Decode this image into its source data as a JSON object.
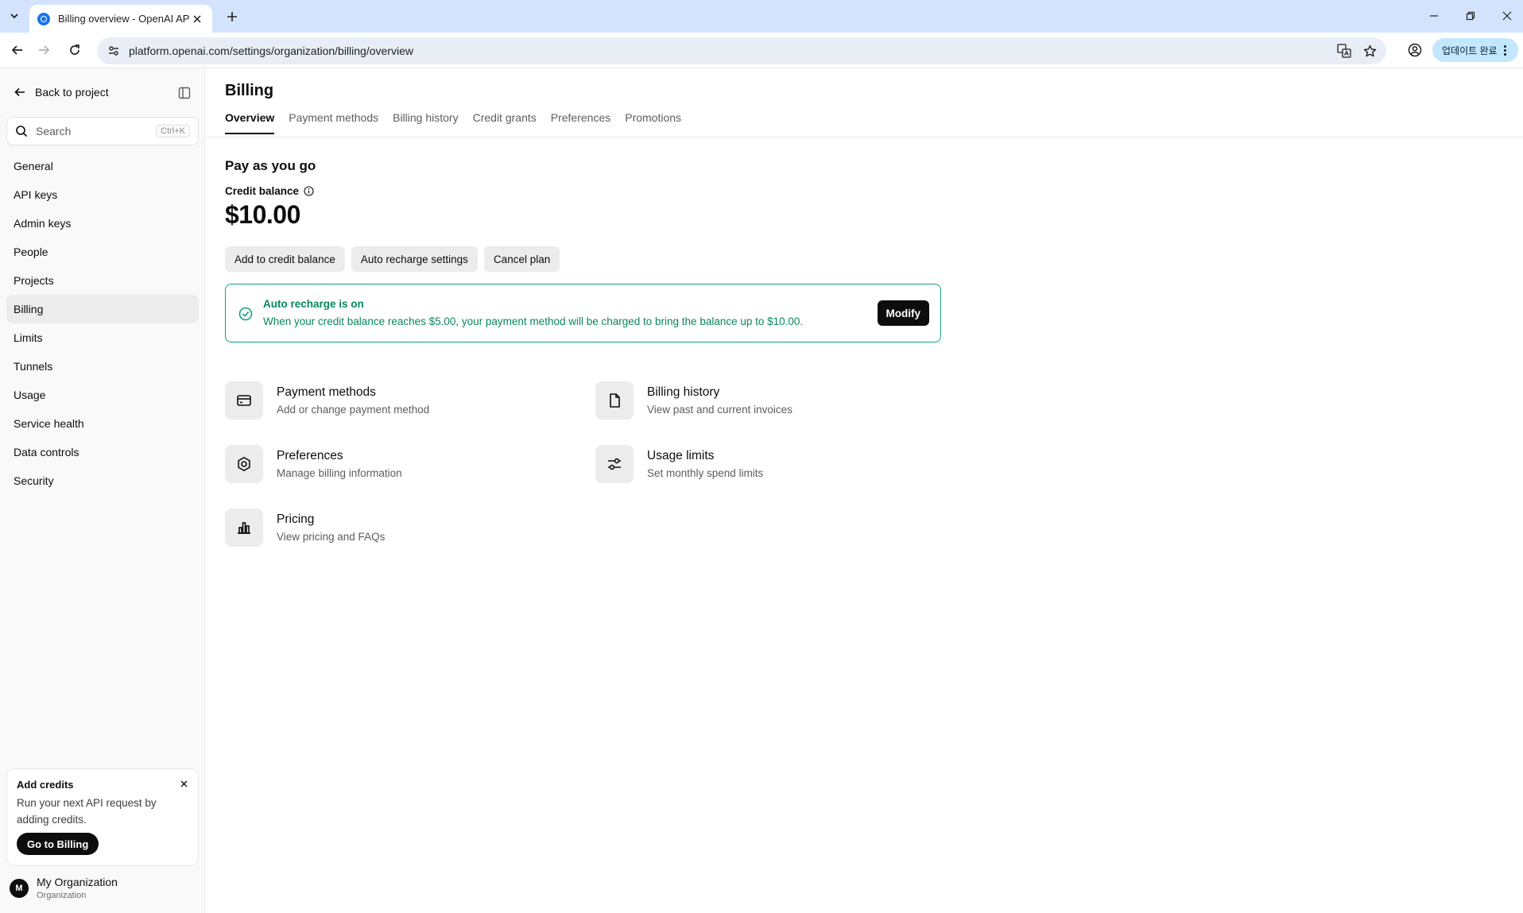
{
  "browser": {
    "tab_title": "Billing overview - OpenAI API",
    "url": "platform.openai.com/settings/organization/billing/overview",
    "update_label": "업데이트 완료"
  },
  "sidebar": {
    "back_label": "Back to project",
    "search": {
      "placeholder": "Search",
      "shortcut": "Ctrl+K"
    },
    "items": [
      {
        "label": "General"
      },
      {
        "label": "API keys"
      },
      {
        "label": "Admin keys"
      },
      {
        "label": "People"
      },
      {
        "label": "Projects"
      },
      {
        "label": "Billing",
        "active": true
      },
      {
        "label": "Limits"
      },
      {
        "label": "Tunnels"
      },
      {
        "label": "Usage"
      },
      {
        "label": "Service health"
      },
      {
        "label": "Data controls"
      },
      {
        "label": "Security"
      }
    ],
    "promo": {
      "title": "Add credits",
      "text": "Run your next API request by adding credits.",
      "button": "Go to Billing"
    },
    "org": {
      "initial": "M",
      "name": "My Organization",
      "subtitle": "Organization"
    }
  },
  "main": {
    "title": "Billing",
    "tabs": [
      {
        "label": "Overview",
        "active": true
      },
      {
        "label": "Payment methods"
      },
      {
        "label": "Billing history"
      },
      {
        "label": "Credit grants"
      },
      {
        "label": "Preferences"
      },
      {
        "label": "Promotions"
      }
    ],
    "plan_title": "Pay as you go",
    "balance_label": "Credit balance",
    "balance": "$10.00",
    "actions": {
      "add_credit": "Add to credit balance",
      "auto_recharge": "Auto recharge settings",
      "cancel": "Cancel plan"
    },
    "alert": {
      "title": "Auto recharge is on",
      "text": "When your credit balance reaches $5.00, your payment method will be charged to bring the balance up to $10.00.",
      "button": "Modify",
      "color": "#10a37f"
    },
    "cards": [
      {
        "title": "Payment methods",
        "subtitle": "Add or change payment method",
        "icon": "credit-card-icon"
      },
      {
        "title": "Billing history",
        "subtitle": "View past and current invoices",
        "icon": "document-icon"
      },
      {
        "title": "Preferences",
        "subtitle": "Manage billing information",
        "icon": "gear-icon"
      },
      {
        "title": "Usage limits",
        "subtitle": "Set monthly spend limits",
        "icon": "sliders-icon"
      },
      {
        "title": "Pricing",
        "subtitle": "View pricing and FAQs",
        "icon": "bar-chart-icon"
      }
    ]
  }
}
